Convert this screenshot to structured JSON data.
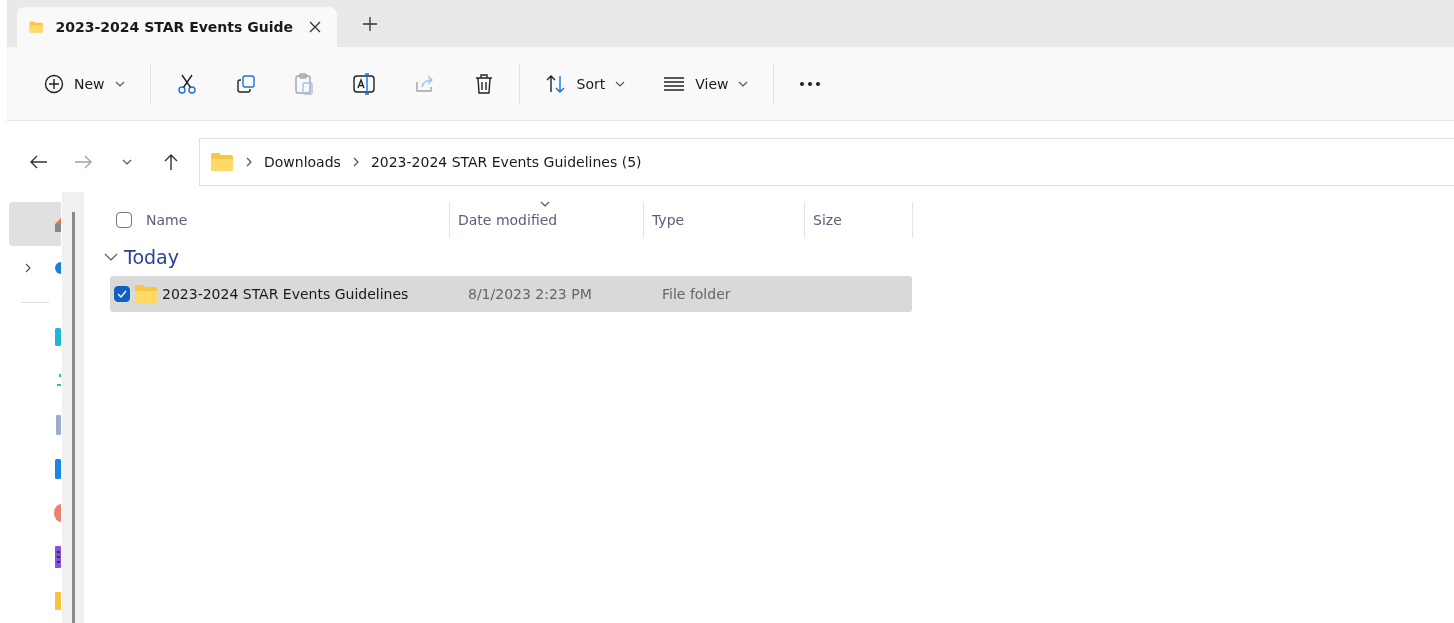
{
  "tabs": [
    {
      "title": "2023-2024 STAR Events Guide",
      "selected": true
    }
  ],
  "toolbar": {
    "buttons": [
      {
        "kind": "new",
        "label": "New",
        "disabled": false
      },
      {
        "kind": "cut",
        "disabled": false
      },
      {
        "kind": "copy",
        "disabled": false
      },
      {
        "kind": "paste",
        "disabled": true
      },
      {
        "kind": "rename",
        "disabled": false
      },
      {
        "kind": "share",
        "disabled": true
      },
      {
        "kind": "delete",
        "disabled": false
      },
      {
        "kind": "sort",
        "label": "Sort",
        "disabled": false
      },
      {
        "kind": "view",
        "label": "View",
        "disabled": false
      },
      {
        "kind": "more",
        "disabled": false
      }
    ]
  },
  "nav": {
    "back_disabled": false,
    "forward_disabled": true,
    "breadcrumb": [
      "Downloads",
      "2023-2024 STAR Events Guidelines (5)"
    ]
  },
  "sidebar": {
    "sections": [
      {
        "items": [
          {
            "kind": "home",
            "color": "#e8743b",
            "selected": true,
            "expandable": false
          },
          {
            "kind": "cloud",
            "color": "#1a7fd6",
            "selected": false,
            "expandable": true
          }
        ]
      },
      {
        "items": [
          {
            "kind": "desktop",
            "color": "#1fb6d6",
            "selected": false,
            "expandable": false
          },
          {
            "kind": "downloads",
            "color": "#2fc28a",
            "selected": false,
            "expandable": false
          },
          {
            "kind": "documents",
            "color": "#9aaec8",
            "selected": false,
            "expandable": false
          },
          {
            "kind": "pictures",
            "color": "#1a86dc",
            "selected": false,
            "expandable": false
          },
          {
            "kind": "music",
            "color": "#e8826a",
            "selected": false,
            "expandable": false
          },
          {
            "kind": "videos",
            "color": "#8a4fdc",
            "selected": false,
            "expandable": false
          },
          {
            "kind": "folder",
            "color": "#f7c23c",
            "selected": false,
            "expandable": false
          }
        ]
      }
    ]
  },
  "select_all_checked": false,
  "columns": [
    "Name",
    "Date modified",
    "Type",
    "Size"
  ],
  "groups": [
    {
      "title": "Today",
      "expanded": true,
      "rows": [
        {
          "name": "2023-2024 STAR Events Guidelines",
          "date_modified": "8/1/2023 2:23 PM",
          "type": "File folder",
          "selected": true,
          "checked": true
        }
      ]
    }
  ]
}
